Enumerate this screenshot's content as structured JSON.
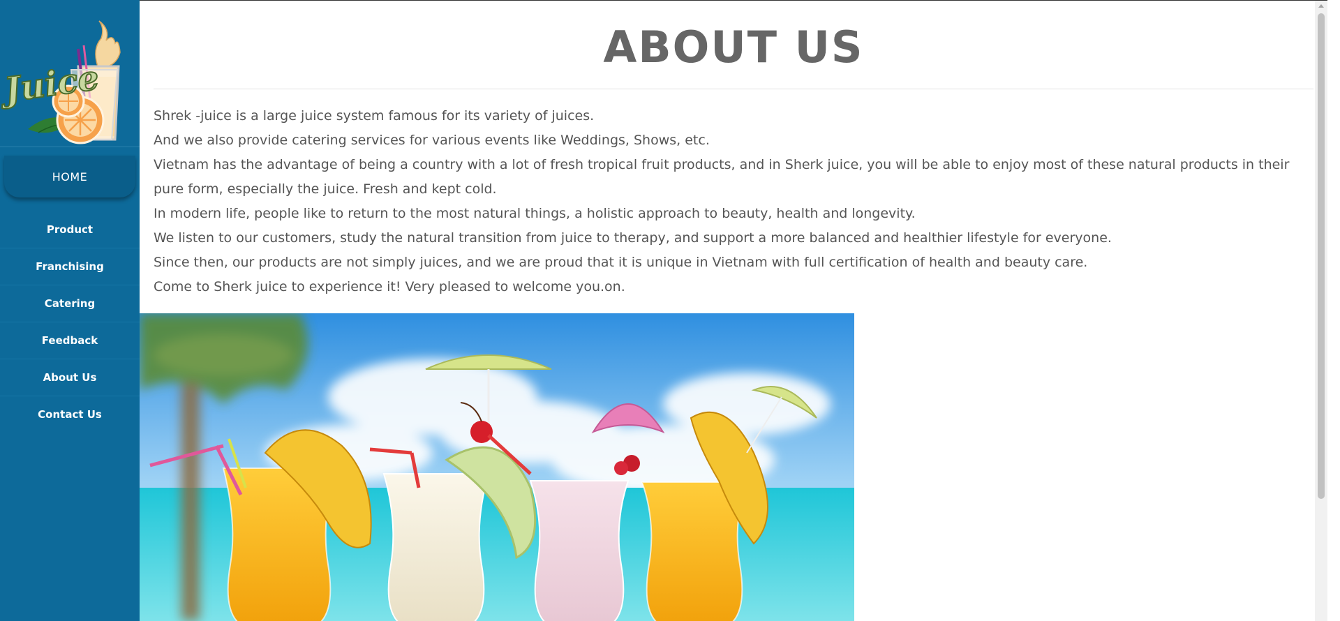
{
  "sidebar": {
    "logo_text": "Juice",
    "home_label": "HOME",
    "items": [
      {
        "label": "Product"
      },
      {
        "label": "Franchising"
      },
      {
        "label": "Catering"
      },
      {
        "label": "Feedback"
      },
      {
        "label": "About Us"
      },
      {
        "label": "Contact Us"
      }
    ]
  },
  "main": {
    "title": "ABOUT US",
    "paragraphs": [
      "Shrek -juice is a large juice system famous for its variety of juices.",
      "And we also provide catering services for various events like Weddings, Shows, etc.",
      "Vietnam has the advantage of being a country with a lot of fresh tropical fruit products, and in Sherk juice, you will be able to enjoy most of these natural products in their pure form, especially the juice. Fresh and kept cold.",
      "In modern life, people like to return to the most natural things, a holistic approach to beauty, health and longevity.",
      "We listen to our customers, study the natural transition from juice to therapy, and support a more balanced and healthier lifestyle for everyone.",
      "Since then, our products are not simply juices, and we are proud that it is unique in Vietnam with full certification of health and beauty care.",
      "Come to Sherk juice to experience it! Very pleased to welcome you.on."
    ]
  },
  "colors": {
    "sidebar_bg": "#0d6a9a",
    "home_bg": "#0a5e8a",
    "title": "#666666",
    "text": "#555555"
  }
}
